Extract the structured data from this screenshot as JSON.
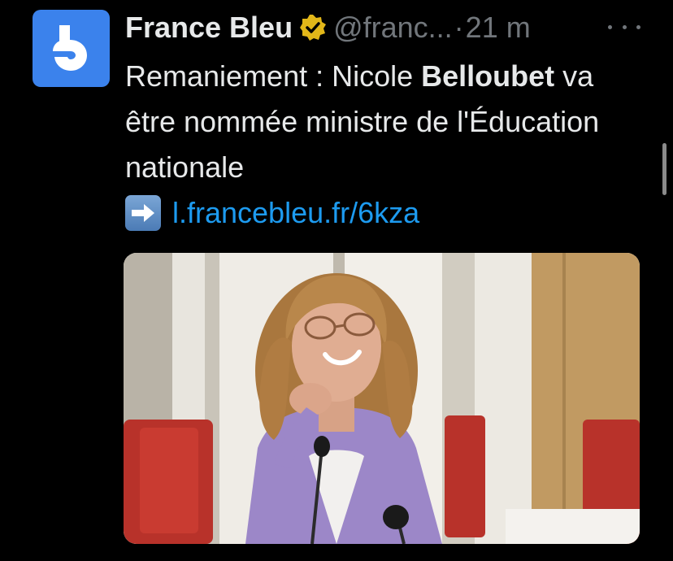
{
  "tweet": {
    "display_name": "France Bleu",
    "handle": "@franc...",
    "separator": "·",
    "time": "21 m",
    "text_before_bold": "Remaniement : Nicole ",
    "text_bold": "Belloubet",
    "text_after_bold": " va être nommée ministre de l'Éducation nationale",
    "link": "l.francebleu.fr/6kza",
    "icons": {
      "avatar": "france-bleu-logo",
      "verified": "verified-badge-icon",
      "more": "more-options-icon",
      "arrow": "right-arrow-emoji-icon"
    }
  },
  "colors": {
    "background": "#000000",
    "text": "#e7e9ea",
    "muted": "#71767b",
    "link": "#1d9bf0",
    "avatar": "#3b82ec",
    "verified_gold": "#e2b719"
  }
}
